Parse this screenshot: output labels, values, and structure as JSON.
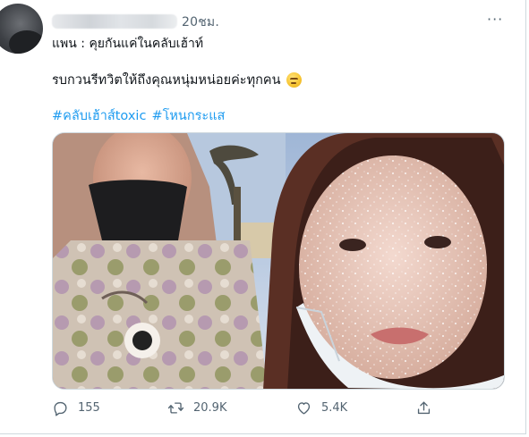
{
  "tweet": {
    "time": "20ชม.",
    "more_label": "···",
    "line1": "แพน : คุยกันแค่ในคลับเฮ้าท์",
    "line2": "รบกวนรีทวิตให้ถึงคุณหนุ่มหน่อยค่ะทุกคน",
    "emoji_icon": "face-with-rolling-eyes-emoji",
    "hashtags": [
      "#คลับเฮ้าส์toxic",
      "#โหนกระแส"
    ],
    "hashtag_color": "#1d9bf0"
  },
  "actions": {
    "reply": {
      "icon": "reply-icon",
      "count": "155"
    },
    "retweet": {
      "icon": "retweet-icon",
      "count": "20.9K"
    },
    "like": {
      "icon": "heart-icon",
      "count": "5.4K"
    },
    "share": {
      "icon": "share-icon",
      "count": ""
    }
  }
}
